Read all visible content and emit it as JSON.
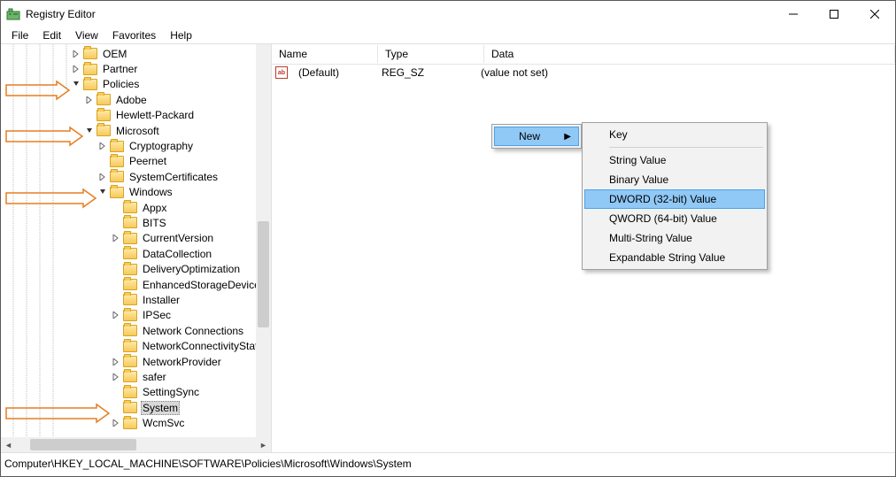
{
  "window": {
    "title": "Registry Editor"
  },
  "menubar": {
    "file": "File",
    "edit": "Edit",
    "view": "View",
    "favorites": "Favorites",
    "help": "Help"
  },
  "tree": {
    "items": [
      {
        "label": "OEM",
        "depth": 5,
        "chev": ">"
      },
      {
        "label": "Partner",
        "depth": 5,
        "chev": ">"
      },
      {
        "label": "Policies",
        "depth": 5,
        "chev": "v",
        "arrow": true
      },
      {
        "label": "Adobe",
        "depth": 6,
        "chev": ">"
      },
      {
        "label": "Hewlett-Packard",
        "depth": 6,
        "chev": ""
      },
      {
        "label": "Microsoft",
        "depth": 6,
        "chev": "v",
        "arrow": true
      },
      {
        "label": "Cryptography",
        "depth": 7,
        "chev": ">"
      },
      {
        "label": "Peernet",
        "depth": 7,
        "chev": ""
      },
      {
        "label": "SystemCertificates",
        "depth": 7,
        "chev": ">"
      },
      {
        "label": "Windows",
        "depth": 7,
        "chev": "v",
        "arrow": true
      },
      {
        "label": "Appx",
        "depth": 8,
        "chev": ""
      },
      {
        "label": "BITS",
        "depth": 8,
        "chev": ""
      },
      {
        "label": "CurrentVersion",
        "depth": 8,
        "chev": ">"
      },
      {
        "label": "DataCollection",
        "depth": 8,
        "chev": ""
      },
      {
        "label": "DeliveryOptimization",
        "depth": 8,
        "chev": ""
      },
      {
        "label": "EnhancedStorageDevices",
        "depth": 8,
        "chev": ""
      },
      {
        "label": "Installer",
        "depth": 8,
        "chev": ""
      },
      {
        "label": "IPSec",
        "depth": 8,
        "chev": ">"
      },
      {
        "label": "Network Connections",
        "depth": 8,
        "chev": ""
      },
      {
        "label": "NetworkConnectivityStatus",
        "depth": 8,
        "chev": ""
      },
      {
        "label": "NetworkProvider",
        "depth": 8,
        "chev": ">"
      },
      {
        "label": "safer",
        "depth": 8,
        "chev": ">"
      },
      {
        "label": "SettingSync",
        "depth": 8,
        "chev": ""
      },
      {
        "label": "System",
        "depth": 8,
        "chev": "",
        "selected": true,
        "arrow": true
      },
      {
        "label": "WcmSvc",
        "depth": 8,
        "chev": ">"
      }
    ]
  },
  "list": {
    "columns": {
      "name": "Name",
      "type": "Type",
      "data": "Data"
    },
    "rows": [
      {
        "name": "(Default)",
        "type": "REG_SZ",
        "data": "(value not set)"
      }
    ]
  },
  "context_menu": {
    "new_label": "New",
    "sub": {
      "key": "Key",
      "string": "String Value",
      "binary": "Binary Value",
      "dword": "DWORD (32-bit) Value",
      "qword": "QWORD (64-bit) Value",
      "multi": "Multi-String Value",
      "expand": "Expandable String Value"
    }
  },
  "statusbar": {
    "path": "Computer\\HKEY_LOCAL_MACHINE\\SOFTWARE\\Policies\\Microsoft\\Windows\\System"
  }
}
